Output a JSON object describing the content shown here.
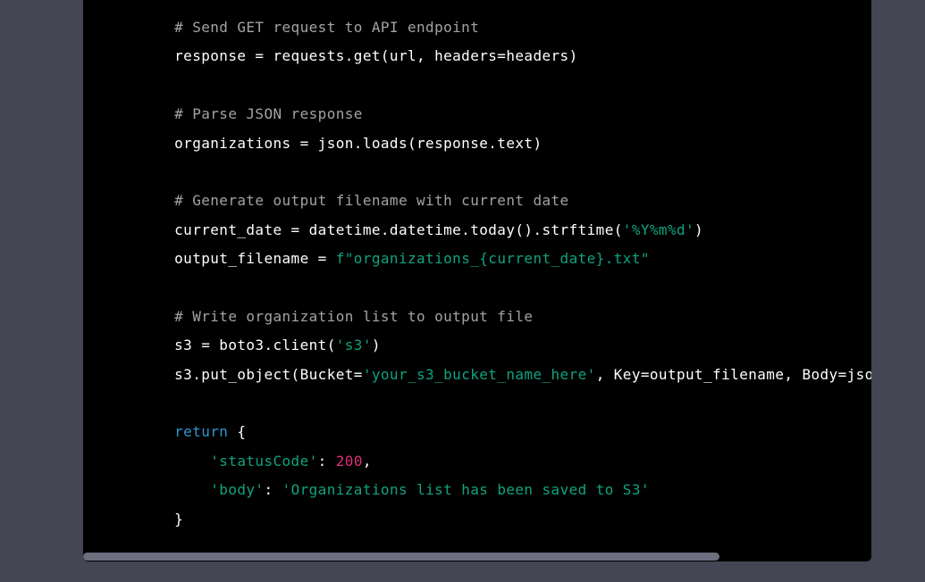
{
  "code": {
    "lines": [
      [
        {
          "type": "comment",
          "text": "    # Send GET request to API endpoint"
        }
      ],
      [
        {
          "type": "plain",
          "text": "    response = requests.get(url, headers=headers)"
        }
      ],
      [
        {
          "type": "plain",
          "text": ""
        }
      ],
      [
        {
          "type": "comment",
          "text": "    # Parse JSON response"
        }
      ],
      [
        {
          "type": "plain",
          "text": "    organizations = json.loads(response.text)"
        }
      ],
      [
        {
          "type": "plain",
          "text": ""
        }
      ],
      [
        {
          "type": "comment",
          "text": "    # Generate output filename with current date"
        }
      ],
      [
        {
          "type": "plain",
          "text": "    current_date = datetime.datetime.today().strftime("
        },
        {
          "type": "string",
          "text": "'%Y%m%d'"
        },
        {
          "type": "plain",
          "text": ")"
        }
      ],
      [
        {
          "type": "plain",
          "text": "    output_filename = "
        },
        {
          "type": "string",
          "text": "f\"organizations_{current_date}.txt\""
        }
      ],
      [
        {
          "type": "plain",
          "text": ""
        }
      ],
      [
        {
          "type": "comment",
          "text": "    # Write organization list to output file"
        }
      ],
      [
        {
          "type": "plain",
          "text": "    s3 = boto3.client("
        },
        {
          "type": "string",
          "text": "'s3'"
        },
        {
          "type": "plain",
          "text": ")"
        }
      ],
      [
        {
          "type": "plain",
          "text": "    s3.put_object(Bucket="
        },
        {
          "type": "string",
          "text": "'your_s3_bucket_name_here'"
        },
        {
          "type": "plain",
          "text": ", Key=output_filename, Body=json.du"
        }
      ],
      [
        {
          "type": "plain",
          "text": ""
        }
      ],
      [
        {
          "type": "keyword",
          "text": "    return"
        },
        {
          "type": "plain",
          "text": " {"
        }
      ],
      [
        {
          "type": "plain",
          "text": "        "
        },
        {
          "type": "string",
          "text": "'statusCode'"
        },
        {
          "type": "plain",
          "text": ": "
        },
        {
          "type": "number",
          "text": "200"
        },
        {
          "type": "plain",
          "text": ","
        }
      ],
      [
        {
          "type": "plain",
          "text": "        "
        },
        {
          "type": "string",
          "text": "'body'"
        },
        {
          "type": "plain",
          "text": ": "
        },
        {
          "type": "string",
          "text": "'Organizations list has been saved to S3'"
        }
      ],
      [
        {
          "type": "plain",
          "text": "    }"
        }
      ]
    ]
  },
  "colors": {
    "background": "#444654",
    "code_background": "#000000",
    "comment": "#a3a3a3",
    "plain": "#ffffff",
    "string": "#10a37f",
    "keyword": "#2e95d3",
    "number": "#df3079",
    "scrollbar_thumb": "#6e6e80"
  },
  "scrollbar": {
    "horizontal_position_fraction": 0.0,
    "visible_fraction": 0.81
  }
}
